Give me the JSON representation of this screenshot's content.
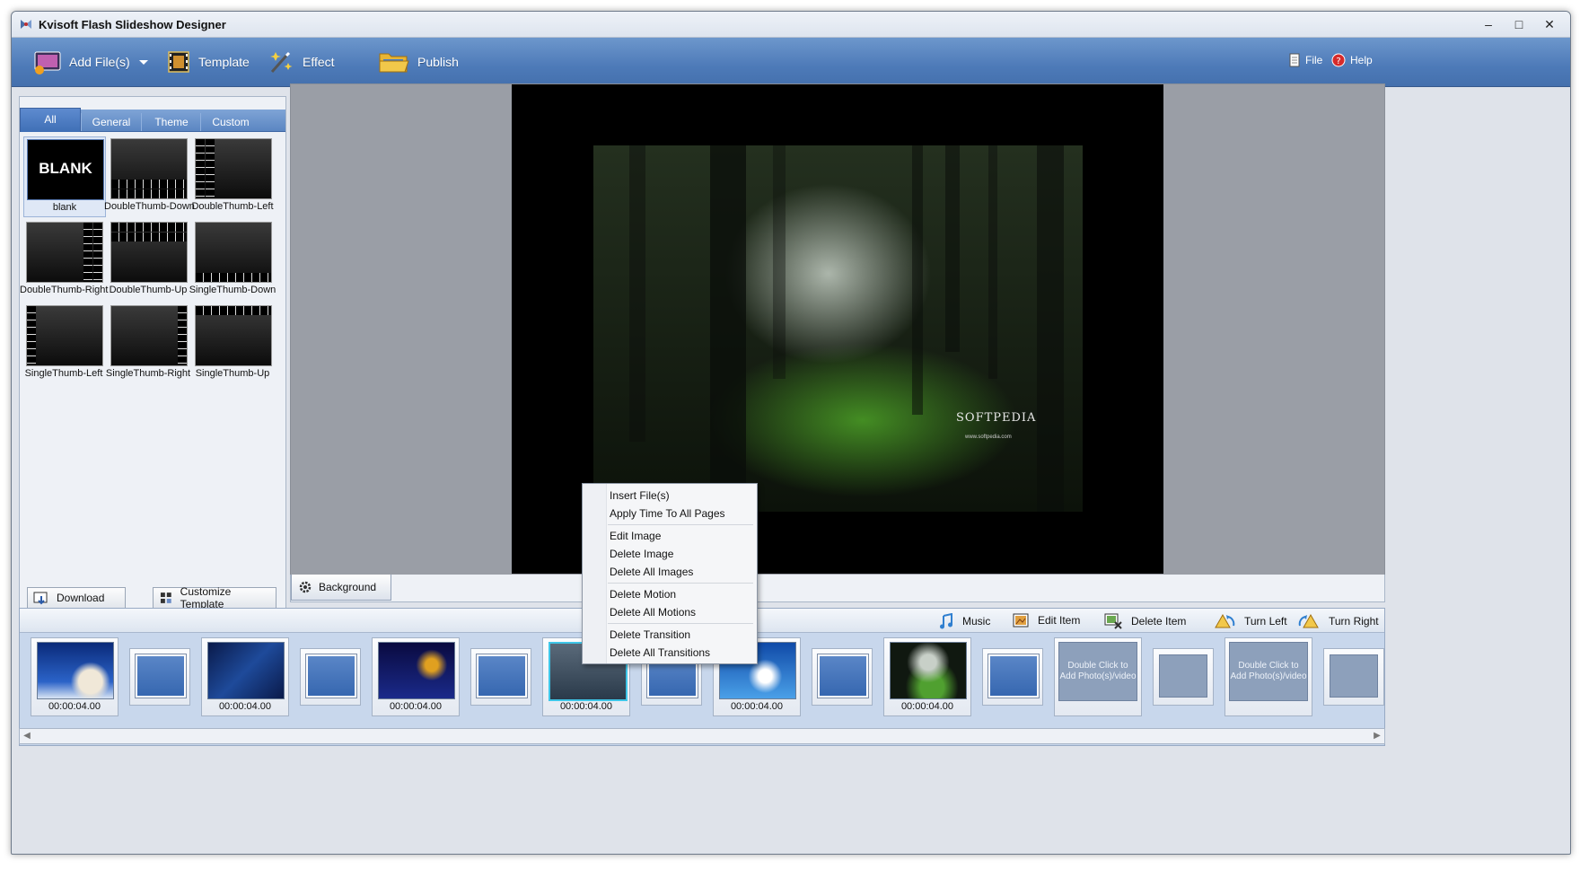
{
  "window": {
    "title": "Kvisoft Flash Slideshow Designer"
  },
  "toolbar": {
    "add_files": "Add File(s)",
    "template": "Template",
    "effect": "Effect",
    "publish": "Publish",
    "file": "File",
    "help": "Help"
  },
  "template_panel": {
    "tabs": [
      "All",
      "General",
      "Theme",
      "Custom"
    ],
    "thumbs": [
      "blank",
      "DoubleThumb-Down",
      "DoubleThumb-Left",
      "DoubleThumb-Right",
      "DoubleThumb-Up",
      "SingleThumb-Down",
      "SingleThumb-Left",
      "SingleThumb-Right",
      "SingleThumb-Up"
    ],
    "blank_text": "BLANK",
    "download": "Download",
    "customize": "Customize Template"
  },
  "preview": {
    "watermark": "SOFTPEDIA",
    "watermark_url": "www.softpedia.com",
    "background_tab": "Background"
  },
  "timeline_toolbar": {
    "music": "Music",
    "edit_item": "Edit Item",
    "delete_item": "Delete Item",
    "turn_left": "Turn Left",
    "turn_right": "Turn Right"
  },
  "timeline": {
    "durations": [
      "00:00:04.00",
      "00:00:04.00",
      "00:00:04.00",
      "00:00:04.00",
      "00:00:04.00",
      "00:00:04.00"
    ],
    "empty_text": "Double Click to Add Photo(s)/video"
  },
  "context_menu": {
    "items": [
      "Insert File(s)",
      "Apply Time To All Pages",
      "Edit Image",
      "Delete Image",
      "Delete All Images",
      "Delete Motion",
      "Delete All Motions",
      "Delete Transition",
      "Delete All Transitions"
    ]
  }
}
